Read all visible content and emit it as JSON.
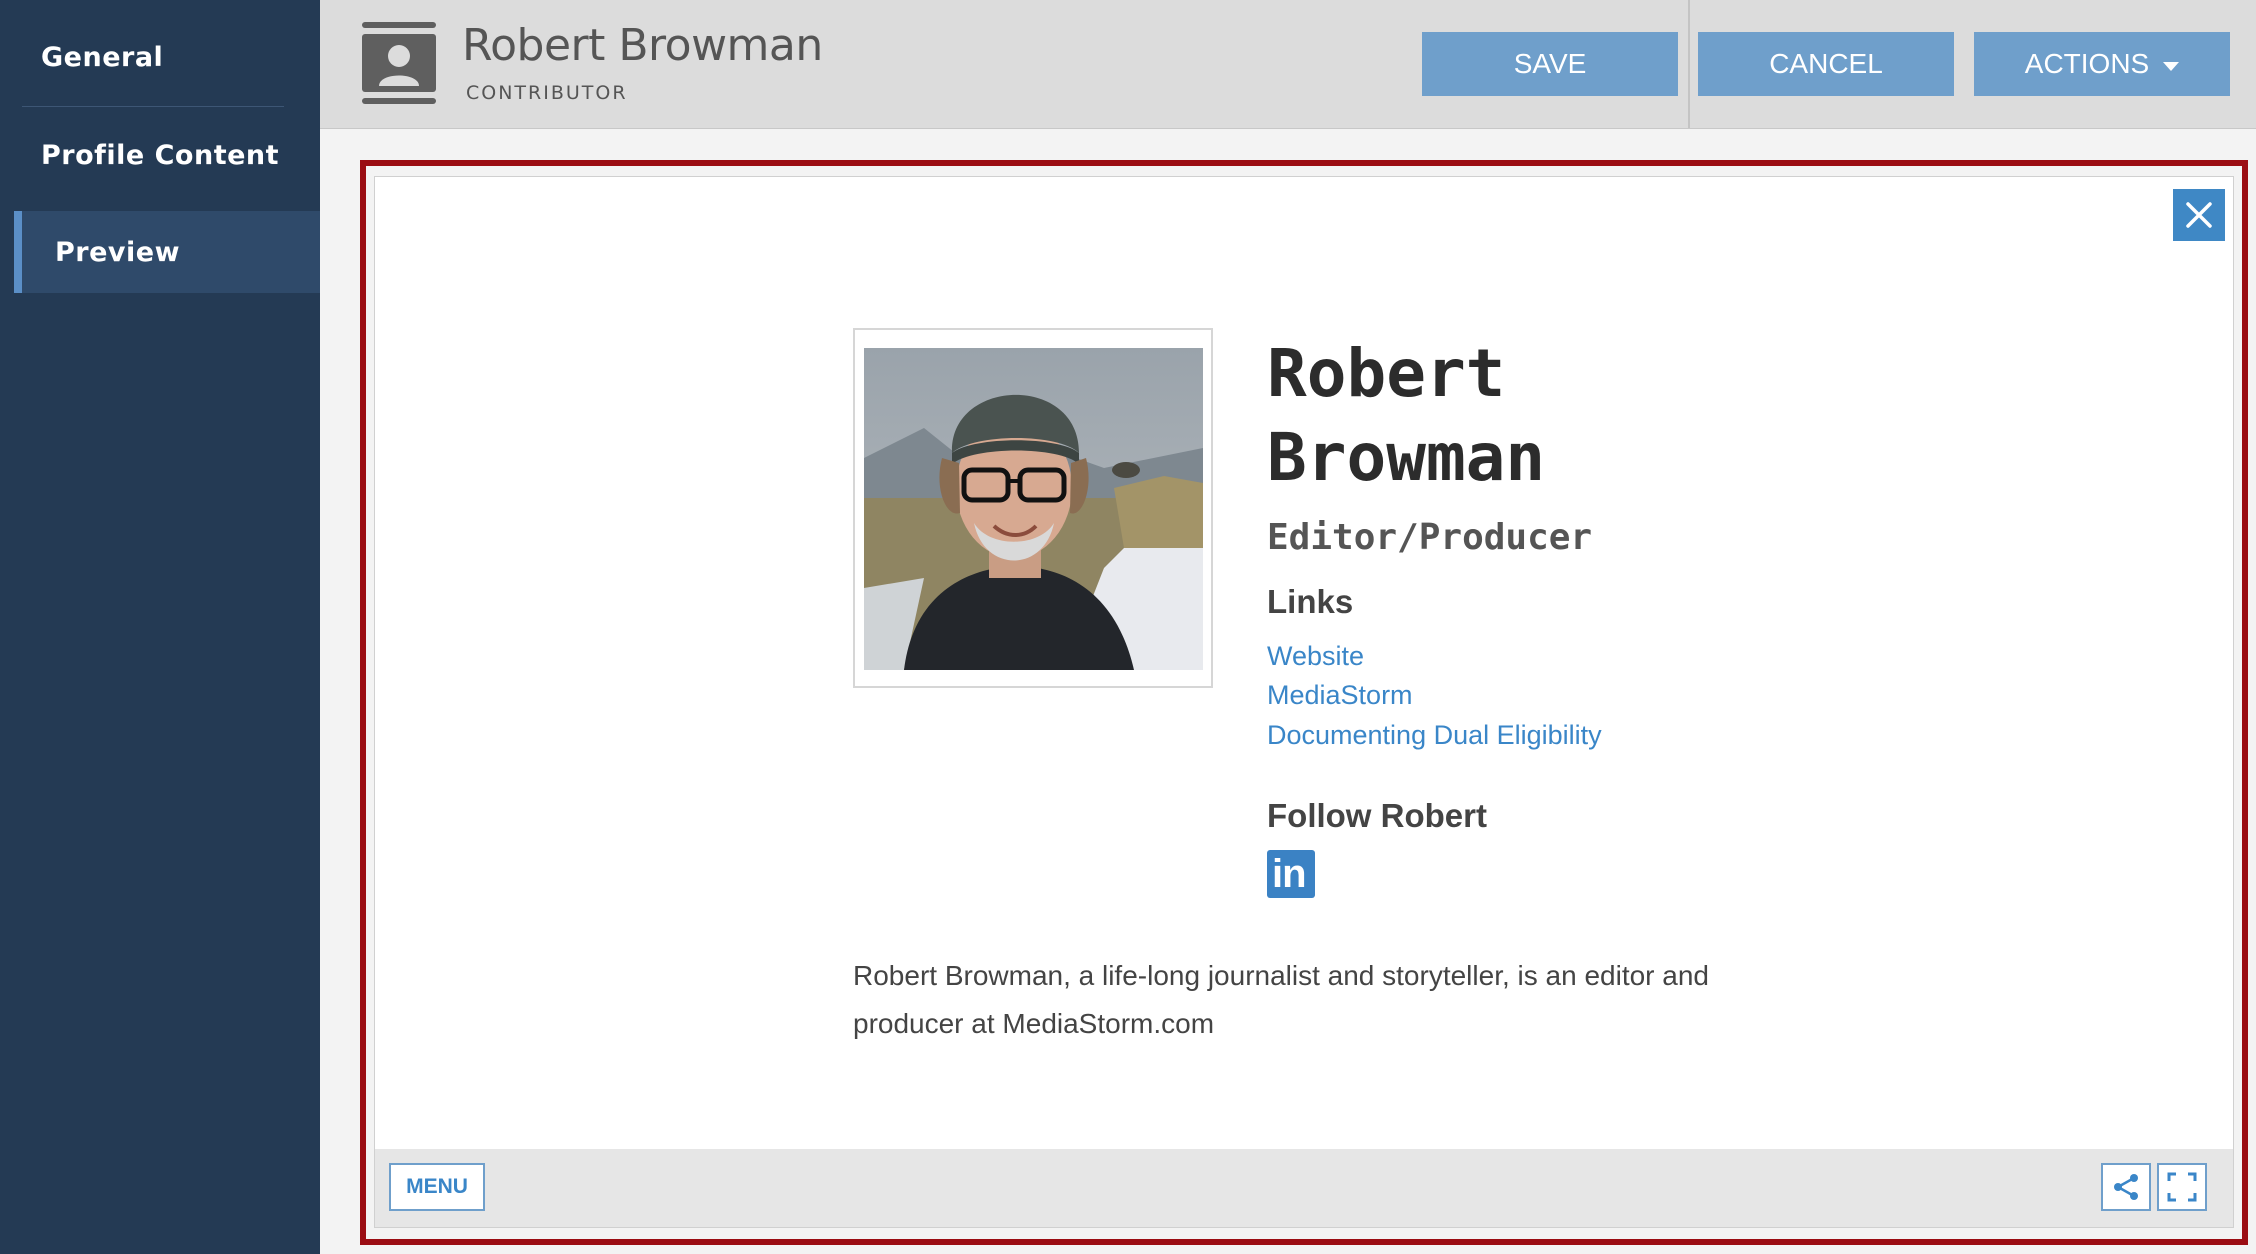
{
  "sidebar": {
    "items": [
      {
        "label": "General"
      },
      {
        "label": "Profile Content"
      },
      {
        "label": "Preview",
        "active": true
      }
    ]
  },
  "header": {
    "name": "Robert Browman",
    "role": "CONTRIBUTOR",
    "icon": "contributor-icon",
    "buttons": {
      "save": "SAVE",
      "cancel": "CANCEL",
      "actions": "ACTIONS"
    }
  },
  "preview": {
    "name_line1": "Robert",
    "name_line2": "Browman",
    "title": "Editor/Producer",
    "links_heading": "Links",
    "links": [
      "Website",
      "MediaStorm",
      "Documenting Dual Eligibility"
    ],
    "follow_heading": "Follow Robert",
    "social_icon": "linkedin-icon",
    "linkedin_text": "in",
    "bio_line1": "Robert Browman, a life-long journalist and storyteller, is an editor and",
    "bio_line2": "producer at MediaStorm.com",
    "footer": {
      "menu": "MENU",
      "share_icon": "share-icon",
      "fullscreen_icon": "fullscreen-icon"
    }
  },
  "colors": {
    "sidebar_bg": "#243a54",
    "accent": "#6f9fcb",
    "link": "#3a86c8",
    "highlight_border": "#9b0d13"
  }
}
